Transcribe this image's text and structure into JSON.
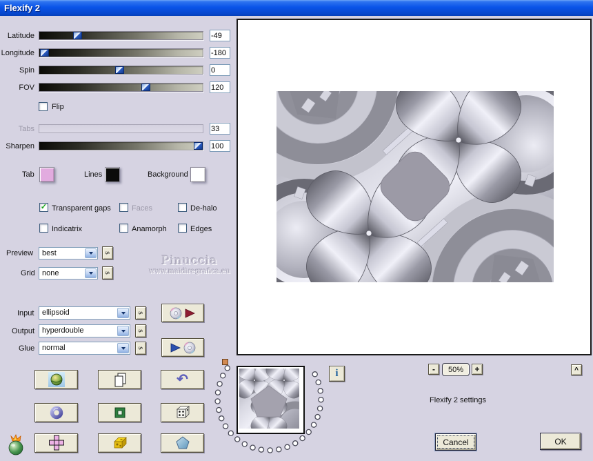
{
  "window": {
    "title": "Flexify 2"
  },
  "colors": {
    "titlebar": "#0a54e8",
    "dialog_bg": "#d6d3e2",
    "button_face": "#ece9d8",
    "slider_thumb_blue": "#2a5ac0",
    "check_green": "#17a317",
    "marker_orange": "#d28a52"
  },
  "sliders": [
    {
      "label": "Latitude",
      "value": "-49",
      "pos_pct": 23,
      "disabled": false
    },
    {
      "label": "Longitude",
      "value": "-180",
      "pos_pct": 3,
      "disabled": false
    },
    {
      "label": "Spin",
      "value": "0",
      "pos_pct": 49,
      "disabled": false
    },
    {
      "label": "FOV",
      "value": "120",
      "pos_pct": 65,
      "disabled": false
    },
    {
      "label": "Tabs",
      "value": "33",
      "pos_pct": 0,
      "disabled": true
    },
    {
      "label": "Sharpen",
      "value": "100",
      "pos_pct": 97,
      "disabled": false
    }
  ],
  "flip": {
    "label": "Flip",
    "checked": false,
    "disabled": false
  },
  "swatches": [
    {
      "label": "Tab",
      "color": "#e2abdf"
    },
    {
      "label": "Lines",
      "color": "#0b0b0b"
    },
    {
      "label": "Background",
      "color": "#ffffff"
    }
  ],
  "checkboxes": [
    {
      "label": "Transparent gaps",
      "checked": true,
      "disabled": false
    },
    {
      "label": "Faces",
      "checked": false,
      "disabled": true
    },
    {
      "label": "De-halo",
      "checked": false,
      "disabled": false
    },
    {
      "label": "Indicatrix",
      "checked": false,
      "disabled": false
    },
    {
      "label": "Anamorph",
      "checked": false,
      "disabled": false
    },
    {
      "label": "Edges",
      "checked": false,
      "disabled": false
    }
  ],
  "combos": [
    {
      "label": "Preview",
      "value": "best"
    },
    {
      "label": "Grid",
      "value": "none"
    },
    {
      "label": "Input",
      "value": "ellipsoid"
    },
    {
      "label": "Output",
      "value": "hyperdouble"
    },
    {
      "label": "Glue",
      "value": "normal"
    }
  ],
  "seed_label": "s",
  "watermark": {
    "title": "Pinuccia",
    "url": "www.maidiregrafica.eu"
  },
  "preview_controls": {
    "zoom_out": "-",
    "zoom_level": "50%",
    "zoom_in": "+",
    "collapse": "^",
    "info": "i"
  },
  "status_text": "Flexify 2 settings",
  "actions": {
    "cancel": "Cancel",
    "ok": "OK"
  },
  "icons": {
    "undo_glyph": "↶",
    "check_glyph": "✓"
  }
}
